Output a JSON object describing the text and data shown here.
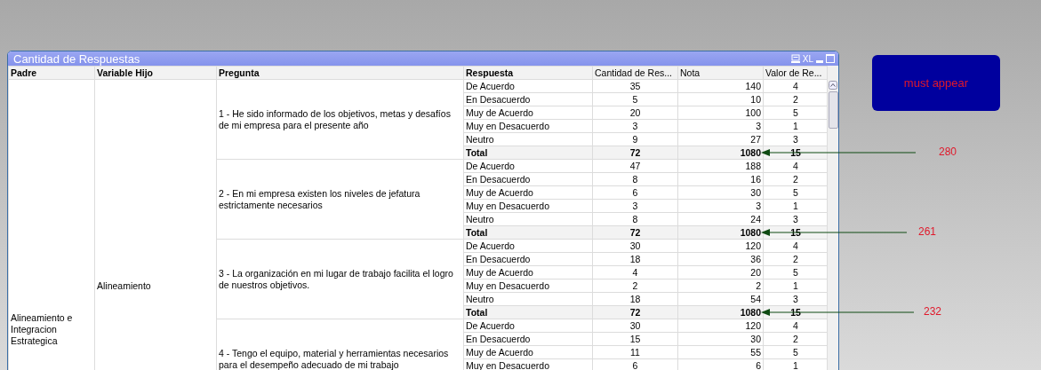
{
  "window": {
    "title": "Cantidad de Respuestas",
    "xl_label": "XL"
  },
  "table": {
    "columns": [
      "Padre",
      "Variable Hijo",
      "Pregunta",
      "Respuesta",
      "Cantidad de Res...",
      "Nota",
      "Valor de Re..."
    ],
    "padre": "Alineamiento e Integracion Estrategica",
    "variable_hijo": "Alineamiento",
    "groups": [
      {
        "pregunta": "1 - He sido informado de los objetivos, metas y desafíos de mi empresa para el presente año",
        "rows": [
          {
            "kind": "detail",
            "respuesta": "De Acuerdo",
            "cantidad": "35",
            "nota": "140",
            "valor": "4"
          },
          {
            "kind": "detail",
            "respuesta": "En Desacuerdo",
            "cantidad": "5",
            "nota": "10",
            "valor": "2"
          },
          {
            "kind": "detail",
            "respuesta": "Muy de Acuerdo",
            "cantidad": "20",
            "nota": "100",
            "valor": "5"
          },
          {
            "kind": "detail",
            "respuesta": "Muy en Desacuerdo",
            "cantidad": "3",
            "nota": "3",
            "valor": "1"
          },
          {
            "kind": "detail",
            "respuesta": "Neutro",
            "cantidad": "9",
            "nota": "27",
            "valor": "3"
          },
          {
            "kind": "total",
            "respuesta": "Total",
            "cantidad": "72",
            "nota": "1080",
            "valor": "15"
          }
        ]
      },
      {
        "pregunta": "2 - En mi empresa existen los niveles de jefatura estrictamente necesarios",
        "rows": [
          {
            "kind": "detail",
            "respuesta": "De Acuerdo",
            "cantidad": "47",
            "nota": "188",
            "valor": "4"
          },
          {
            "kind": "detail",
            "respuesta": "En Desacuerdo",
            "cantidad": "8",
            "nota": "16",
            "valor": "2"
          },
          {
            "kind": "detail",
            "respuesta": "Muy de Acuerdo",
            "cantidad": "6",
            "nota": "30",
            "valor": "5"
          },
          {
            "kind": "detail",
            "respuesta": "Muy en Desacuerdo",
            "cantidad": "3",
            "nota": "3",
            "valor": "1"
          },
          {
            "kind": "detail",
            "respuesta": "Neutro",
            "cantidad": "8",
            "nota": "24",
            "valor": "3"
          },
          {
            "kind": "total",
            "respuesta": "Total",
            "cantidad": "72",
            "nota": "1080",
            "valor": "15"
          }
        ]
      },
      {
        "pregunta": "3 - La organización en mi lugar de trabajo facilita el logro de nuestros objetivos.",
        "rows": [
          {
            "kind": "detail",
            "respuesta": "De Acuerdo",
            "cantidad": "30",
            "nota": "120",
            "valor": "4"
          },
          {
            "kind": "detail",
            "respuesta": "En Desacuerdo",
            "cantidad": "18",
            "nota": "36",
            "valor": "2"
          },
          {
            "kind": "detail",
            "respuesta": "Muy de Acuerdo",
            "cantidad": "4",
            "nota": "20",
            "valor": "5"
          },
          {
            "kind": "detail",
            "respuesta": "Muy en Desacuerdo",
            "cantidad": "2",
            "nota": "2",
            "valor": "1"
          },
          {
            "kind": "detail",
            "respuesta": "Neutro",
            "cantidad": "18",
            "nota": "54",
            "valor": "3"
          },
          {
            "kind": "total",
            "respuesta": "Total",
            "cantidad": "72",
            "nota": "1080",
            "valor": "15"
          }
        ]
      },
      {
        "pregunta": "4 - Tengo el equipo, material y herramientas necesarios para el desempeño adecuado de mi trabajo",
        "rows": [
          {
            "kind": "detail",
            "respuesta": "De Acuerdo",
            "cantidad": "30",
            "nota": "120",
            "valor": "4"
          },
          {
            "kind": "detail",
            "respuesta": "En Desacuerdo",
            "cantidad": "15",
            "nota": "30",
            "valor": "2"
          },
          {
            "kind": "detail",
            "respuesta": "Muy de Acuerdo",
            "cantidad": "11",
            "nota": "55",
            "valor": "5"
          },
          {
            "kind": "detail",
            "respuesta": "Muy en Desacuerdo",
            "cantidad": "6",
            "nota": "6",
            "valor": "1"
          }
        ]
      }
    ]
  },
  "button": {
    "label": "must appear"
  },
  "annotations": [
    {
      "label": "280"
    },
    {
      "label": "261"
    },
    {
      "label": "232"
    }
  ]
}
